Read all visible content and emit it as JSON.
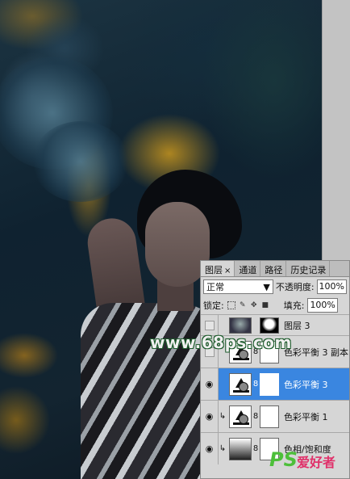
{
  "watermark": {
    "url_text": "www.68ps.com",
    "logo_ps": "PS",
    "logo_cn": "爱好者"
  },
  "layers_panel": {
    "tabs": [
      {
        "label": "图层",
        "close": "×",
        "active": true
      },
      {
        "label": "通道",
        "active": false
      },
      {
        "label": "路径",
        "active": false
      },
      {
        "label": "历史记录",
        "active": false
      }
    ],
    "blend_mode": "正常",
    "opacity_label": "不透明度:",
    "opacity_value": "100%",
    "lock_label": "锁定:",
    "fill_label": "填充:",
    "fill_value": "100%",
    "layers": [
      {
        "name": "图层 3",
        "visible": false,
        "selected": false,
        "partial": true
      },
      {
        "name": "色彩平衡 3 副本",
        "visible": false,
        "selected": false
      },
      {
        "name": "色彩平衡 3",
        "visible": true,
        "selected": true
      },
      {
        "name": "色彩平衡 1",
        "visible": true,
        "selected": false,
        "clipped": true
      },
      {
        "name": "色相/饱和度",
        "visible": true,
        "selected": false
      }
    ]
  },
  "colors": {
    "selected_row": "#3a86e0",
    "watermark_outline": "#1b5a2a",
    "logo_ps": "#4dbf3a",
    "logo_cn": "#e0306a"
  }
}
